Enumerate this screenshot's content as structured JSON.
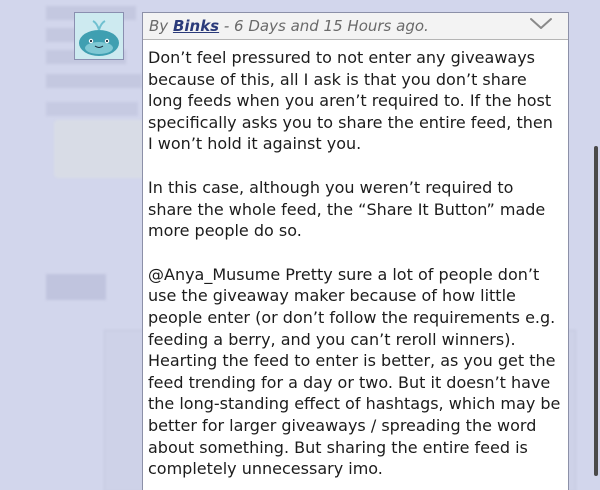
{
  "comment": {
    "by_prefix": "By ",
    "author": "Binks",
    "time_text": " - 6 Days and 15 Hours ago.",
    "paragraphs": [
      "Don’t feel pressured to not enter any giveaways because of this, all I ask is that you don’t share long feeds when you aren’t required to. If the host specifically asks you to share the entire feed, then I won’t hold it against you.",
      "In this case, although you weren’t required to share the whole feed, the “Share It Button” made more people do so.",
      "@Anya_Musume Pretty sure a lot of people don’t use the giveaway maker because of how little people enter (or don’t follow the requirements e.g. feeding a berry, and you can’t reroll winners). Hearting the feed to enter is better, as you get the feed trending for a day or two. But it doesn’t have the long-standing effect of hashtags, which may be better for larger giveaways / spreading the word about something. But sharing the entire feed is completely unnecessary imo."
    ]
  },
  "icons": {
    "avatar": "whale-avatar",
    "collapse": "chevron-down-icon"
  },
  "colors": {
    "background": "#d2d6ec",
    "author_link": "#2a3a7a",
    "card_border": "#8c90a8"
  }
}
